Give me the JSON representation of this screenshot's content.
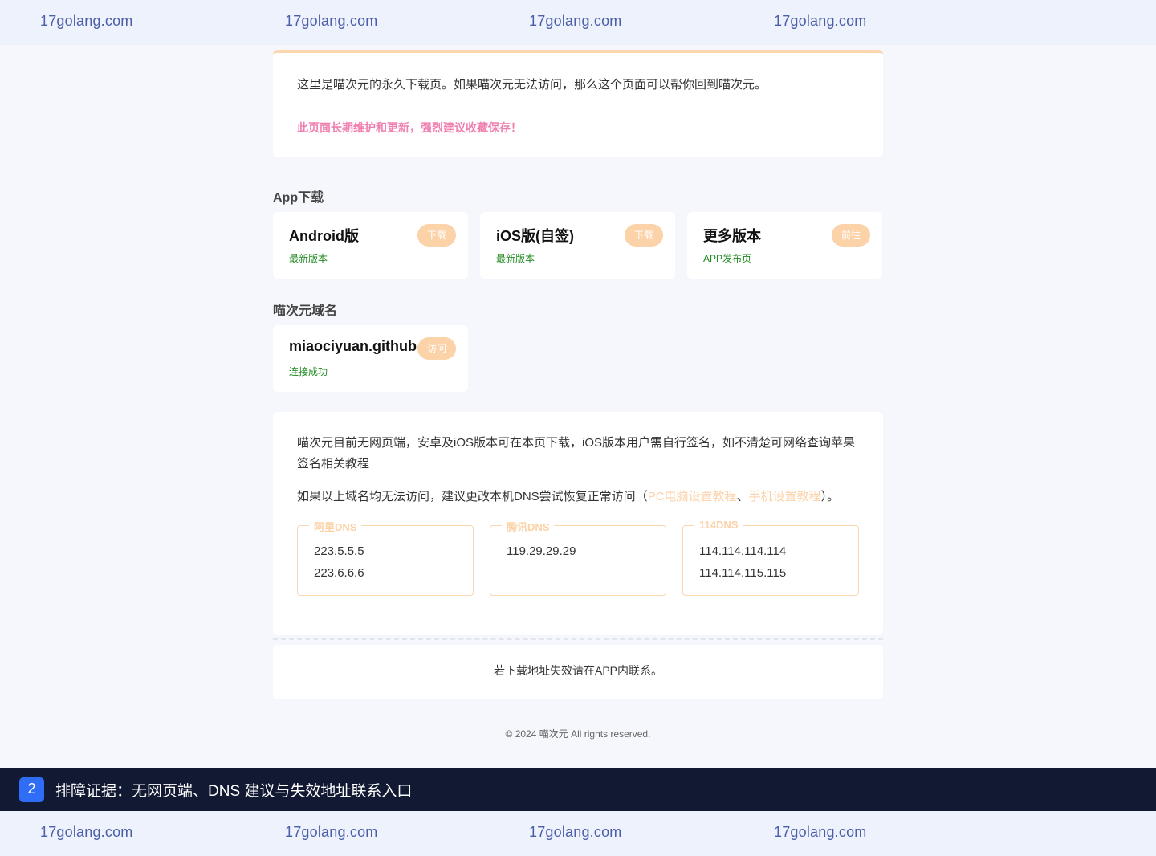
{
  "watermark": {
    "top": [
      "17golang.com",
      "17golang.com",
      "17golang.com",
      "17golang.com"
    ],
    "bottom": [
      "17golang.com",
      "17golang.com",
      "17golang.com",
      "17golang.com"
    ]
  },
  "notice": {
    "intro": "这里是喵次元的永久下载页。如果喵次元无法访问，那么这个页面可以帮你回到喵次元。",
    "warning": "此页面长期维护和更新，强烈建议收藏保存！"
  },
  "app_section": {
    "title": "App下载",
    "cards": [
      {
        "name": "Android版",
        "sub": "最新版本",
        "action": "下载"
      },
      {
        "name": "iOS版(自签)",
        "sub": "最新版本",
        "action": "下载"
      },
      {
        "name": "更多版本",
        "sub": "APP发布页",
        "action": "前往"
      }
    ]
  },
  "domain_section": {
    "title": "喵次元域名",
    "cards": [
      {
        "name": "miaociyuan.github",
        "sub": "连接成功",
        "action": "访问"
      }
    ]
  },
  "info": {
    "text1": "喵次元目前无网页端，安卓及iOS版本可在本页下载，iOS版本用户需自行签名，如不清楚可网络查询苹果签名相关教程",
    "text2_prefix": "如果以上域名均无法访问，建议更改本机DNS尝试恢复正常访问（",
    "link_pc": "PC电脑设置教程",
    "sep": "、",
    "link_mobile": "手机设置教程",
    "text2_suffix": "）。",
    "dns": [
      {
        "label": "阿里DNS",
        "ips": [
          "223.5.5.5",
          "223.6.6.6"
        ]
      },
      {
        "label": "腾讯DNS",
        "ips": [
          "119.29.29.29"
        ]
      },
      {
        "label": "114DNS",
        "ips": [
          "114.114.114.114",
          "114.114.115.115"
        ]
      }
    ]
  },
  "footer_note": "若下载地址失效请在APP内联系。",
  "copyright": "© 2024 喵次元 All rights reserved.",
  "caption": {
    "number": "2",
    "text": "排障证据：无网页端、DNS 建议与失效地址联系入口"
  },
  "colors": {
    "accent_orange": "#fcd2a8",
    "warning_pink": "#f07fb0",
    "success_green": "#1f8a1f",
    "caption_bg": "#121a33",
    "caption_badge": "#2f6df6"
  }
}
